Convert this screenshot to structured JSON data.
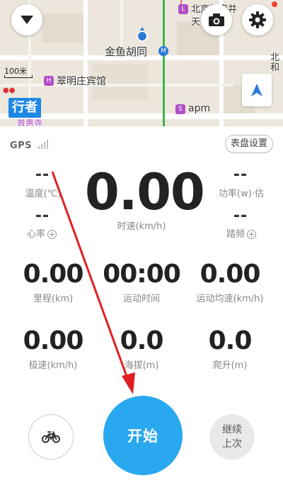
{
  "map": {
    "labels": {
      "jinyu": "金鱼胡同",
      "cuiming": "翠明庄宾馆",
      "apm": "apm",
      "beijing_top": "北京王府井",
      "tian": "天",
      "bei_right": "北",
      "he_right": "和",
      "puhui": "普惠寺"
    },
    "scale_label": "100米",
    "logo_text": "行者",
    "icons": {
      "menu": "chevron-down-icon",
      "camera": "camera-icon",
      "settings": "gear-icon",
      "locate": "navigation-arrow-icon"
    }
  },
  "dashboard": {
    "gps_label": "GPS",
    "panel_settings_label": "表盘设置",
    "temperature": {
      "value": "--",
      "label": "温度(℃)"
    },
    "heart_rate": {
      "value": "--",
      "label": "心率"
    },
    "power": {
      "value": "--",
      "label": "功率(w)·估"
    },
    "cadence": {
      "value": "--",
      "label": "踏频"
    },
    "speed": {
      "value": "0.00",
      "label": "时速(km/h)"
    },
    "distance": {
      "value": "0.00",
      "label": "里程(km)"
    },
    "moving_time": {
      "value": "00:00",
      "label": "运动时间"
    },
    "avg_speed": {
      "value": "0.00",
      "label": "运动均速(km/h)"
    },
    "max_speed": {
      "value": "0.00",
      "label": "极速(km/h)"
    },
    "altitude": {
      "value": "0.0",
      "label": "海拔(m)"
    },
    "climb": {
      "value": "0.0",
      "label": "爬升(m)"
    }
  },
  "actions": {
    "start_label": "开始",
    "resume_line1": "继续",
    "resume_line2": "上次",
    "bike_icon": "bicycle-icon"
  },
  "colors": {
    "accent": "#29a8f0",
    "annotation_arrow": "#e02020",
    "poi": "#b04fc6",
    "logo": "#1e88e5"
  }
}
